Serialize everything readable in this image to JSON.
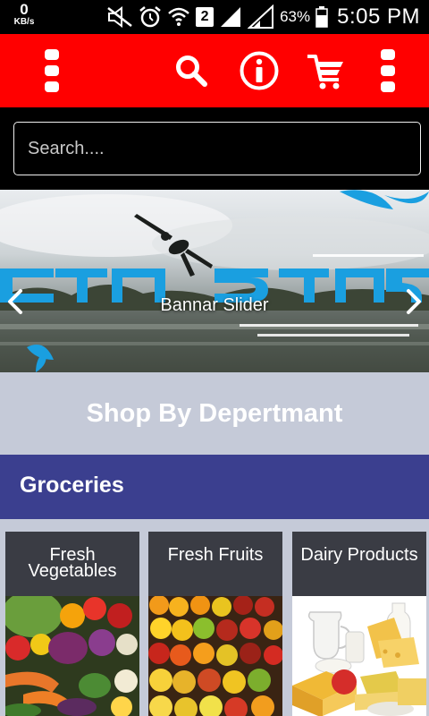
{
  "status_bar": {
    "net_speed": "0",
    "net_unit": "KB/s",
    "sim_slot": "2",
    "battery_percent": "63%",
    "time": "5:05 PM"
  },
  "app_bar": {
    "icons": [
      "menu-icon",
      "search-icon",
      "info-icon",
      "cart-icon",
      "more-icon"
    ],
    "background_color": "#ff0000"
  },
  "search": {
    "placeholder": "Search...."
  },
  "banner": {
    "caption": "Bannar Slider"
  },
  "department": {
    "title": "Shop By Depertmant"
  },
  "category": {
    "title": "Groceries",
    "background_color": "#3b3f8f"
  },
  "products": [
    {
      "label": "Fresh Vegetables"
    },
    {
      "label": "Fresh Fruits"
    },
    {
      "label": "Dairy Products"
    }
  ]
}
